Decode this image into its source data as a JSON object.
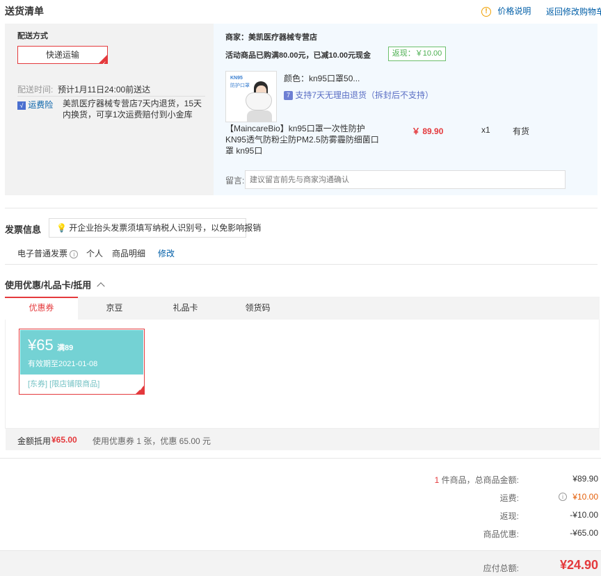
{
  "header": {
    "title": "送货清单",
    "price_note": "价格说明",
    "back_to_cart": "返回修改购物车"
  },
  "delivery": {
    "method_label": "配送方式",
    "method_value": "快递运输",
    "time_label": "配送时间:",
    "time_value": "预计1月11日24:00前送达",
    "insurance_label": "运费险",
    "insurance_desc": "美凯医疗器械专营店7天内退货，15天内换货，可享1次运费赔付到小金库"
  },
  "shop": {
    "merchant": "商家：美凯医疗器械专营店",
    "promo": "活动商品已购满80.00元，已减10.00元现金",
    "rebate_badge": "返现：￥10.00",
    "product": {
      "thumb_line1": "KN95",
      "thumb_line2": "防护口罩",
      "color": "颜色：kn95口罩50...",
      "return_policy": "支持7天无理由退货（拆封后不支持）",
      "name": "【MaincareBio】kn95口罩一次性防护KN95透气防粉尘防PM2.5防雾霾防细菌口罩 kn95口",
      "price": "￥ 89.90",
      "qty": "x1",
      "stock": "有货"
    },
    "message_label": "留言:",
    "message_placeholder": "建议留言前先与商家沟通确认"
  },
  "invoice": {
    "title": "发票信息",
    "tip": "开企业抬头发票须填写纳税人识别号，以免影响报销",
    "type": "电子普通发票",
    "person": "个人",
    "detail": "商品明细",
    "modify": "修改"
  },
  "discount": {
    "title": "使用优惠/礼品卡/抵用",
    "tabs": [
      "优惠券",
      "京豆",
      "礼品卡",
      "领货码"
    ],
    "coupon": {
      "amount": "¥65",
      "condition": "满89",
      "valid": "有效期至2021-01-08",
      "tags": "[东券] [限店铺限商品]"
    },
    "summary_label": "金额抵用",
    "summary_amount": "¥65.00",
    "summary_desc": "使用优惠券 1 张，优惠 65.00 元"
  },
  "totals": {
    "count": "1",
    "goods_label": "件商品，总商品金额:",
    "goods_value": "¥89.90",
    "shipping_label": "运费:",
    "shipping_value": "¥10.00",
    "cashback_label": "返现:",
    "cashback_value": "-¥10.00",
    "discount_label": "商品优惠:",
    "discount_value": "-¥65.00",
    "payable_label": "应付总额:",
    "payable_value": "¥24.90"
  },
  "colors": {
    "accent_red": "#e4393c",
    "link_blue": "#005ea7",
    "coupon_teal": "#74d2d4",
    "rebate_green": "#4caf50"
  }
}
